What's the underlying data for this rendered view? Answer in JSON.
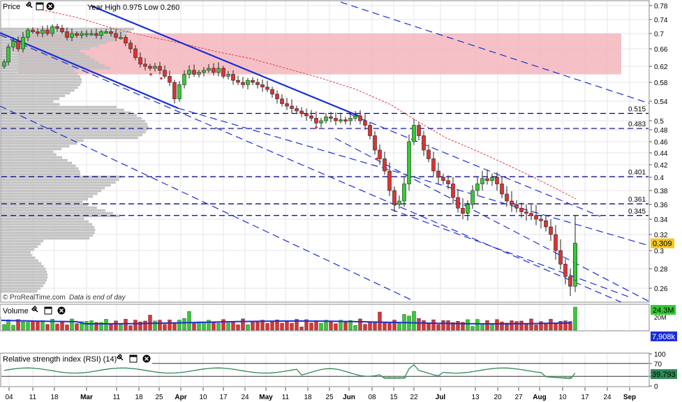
{
  "price_panel": {
    "title": "Price",
    "year_range_text": "Year High 0.975 Low 0.260",
    "last_price": "0.309",
    "watermark": "© ProRealTime.com",
    "footnote": "Data is end of day",
    "y_ticks": [
      "0.78",
      "0.74",
      "0.7",
      "0.66",
      "0.62",
      "0.58",
      "0.54",
      "0.5",
      "0.48",
      "0.46",
      "0.44",
      "0.42",
      "0.4",
      "0.38",
      "0.36",
      "0.34",
      "0.32",
      "0.3",
      "0.28",
      "0.26"
    ],
    "y_tick_values": [
      0.78,
      0.74,
      0.7,
      0.66,
      0.62,
      0.58,
      0.54,
      0.5,
      0.48,
      0.46,
      0.44,
      0.42,
      0.4,
      0.38,
      0.36,
      0.34,
      0.32,
      0.3,
      0.28,
      0.26
    ],
    "levels": [
      {
        "label": "0.515",
        "value": 0.515
      },
      {
        "label": "0.483",
        "value": 0.483
      },
      {
        "label": "0.401",
        "value": 0.401
      },
      {
        "label": "0.361",
        "value": 0.361
      },
      {
        "label": "0.345",
        "value": 0.345
      }
    ],
    "resistance_zone": {
      "from": 0.6,
      "to": 0.7,
      "color": "#f4b6bc"
    },
    "colors": {
      "up": "#33cc33",
      "down": "#dd3333",
      "ma": "#e04040",
      "trend": "#1a2fd4",
      "level": "#000080",
      "last_price_bg": "#f5c518"
    }
  },
  "volume_panel": {
    "title": "Volume",
    "last_volume": "24.3M",
    "scale_label": "20M",
    "avg_volume": "7,908k",
    "ma_color": "#1a2fd4"
  },
  "rsi_panel": {
    "title": "Relative strength index (RSI) (14)",
    "y_ticks": [
      "100",
      "70",
      "30",
      "0"
    ],
    "y_tick_values": [
      100,
      70,
      30,
      0
    ],
    "last_value": "39.793",
    "line_color": "#2e8b57"
  },
  "x_axis": {
    "labels": [
      "04",
      "11",
      "18",
      "Mar",
      "11",
      "18",
      "25",
      "Apr",
      "10",
      "17",
      "24",
      "May",
      "11",
      "18",
      "25",
      "Jun",
      "08",
      "15",
      "22",
      "Jul",
      "13",
      "20",
      "27",
      "Aug",
      "10",
      "17",
      "24",
      "Sep"
    ],
    "month_labels": [
      "Mar",
      "Apr",
      "May",
      "Jun",
      "Jul",
      "Aug",
      "Sep"
    ]
  },
  "chart_data": {
    "type": "candlestick",
    "series": [
      {
        "name": "Price",
        "points": [
          {
            "date": "Feb",
            "close": 0.66
          },
          {
            "date": "Mar 11",
            "close": 0.7
          },
          {
            "date": "Mar 25",
            "close": 0.59
          },
          {
            "date": "Apr",
            "close": 0.54
          },
          {
            "date": "Apr 10",
            "close": 0.62
          },
          {
            "date": "May",
            "close": 0.57
          },
          {
            "date": "May 18",
            "close": 0.51
          },
          {
            "date": "Jun",
            "close": 0.5
          },
          {
            "date": "Jun 08",
            "close": 0.43
          },
          {
            "date": "Jun 15",
            "close": 0.355
          },
          {
            "date": "Jun 22",
            "close": 0.5
          },
          {
            "date": "Jul",
            "close": 0.4
          },
          {
            "date": "Jul 06",
            "close": 0.345
          },
          {
            "date": "Jul 20",
            "close": 0.4
          },
          {
            "date": "Aug",
            "close": 0.34
          },
          {
            "date": "Aug 10",
            "close": 0.262
          },
          {
            "date": "Aug 14",
            "close": 0.309
          }
        ]
      }
    ],
    "year_high": 0.975,
    "year_low": 0.26,
    "volume_last": 24.3,
    "volume_avg": 7.908,
    "rsi_last": 39.793
  }
}
